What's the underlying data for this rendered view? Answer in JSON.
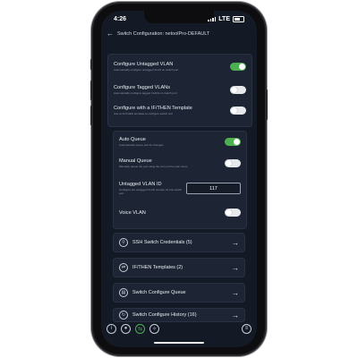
{
  "status": {
    "time": "4:26",
    "network": "LTE"
  },
  "nav": {
    "title": "Switch Configuration: netoolPro-DEFAULT"
  },
  "configure": [
    {
      "label": "Configure Untagged VLAN",
      "desc": "Automatically configure untagged VLAN on switch port",
      "on": true
    },
    {
      "label": "Configure Tagged VLANs",
      "desc": "Automatically configure tagged VLANs on switch port",
      "on": false
    },
    {
      "label": "Configure with a IF/THEN Template",
      "desc": "Use an IF/THEN template to configure switch port",
      "on": false
    }
  ],
  "queue": [
    {
      "label": "Auto Queue",
      "desc": "Automatically queue port for changes",
      "on": true
    },
    {
      "label": "Manual Queue",
      "desc": "Manually queue the port using the icon on the main menu",
      "on": false
    }
  ],
  "untagged_vlan": {
    "label": "Untagged VLAN ID",
    "desc": "Configure the untagged VLAN number for this switch port",
    "value": "117"
  },
  "voice_vlan": {
    "label": "Voice VLAN",
    "on": false
  },
  "links": [
    {
      "label": "SSH Switch Credentials (5)",
      "icon": "key-icon"
    },
    {
      "label": "IF/THEN Templates (2)",
      "icon": "arrows-icon"
    },
    {
      "label": "Switch Configure Queue",
      "icon": "queue-icon"
    },
    {
      "label": "Switch Configure History (16)",
      "icon": "history-icon"
    }
  ],
  "tabs": [
    "info-icon",
    "light-icon",
    "switch-icon",
    "tools-icon",
    "menu-icon"
  ],
  "colors": {
    "accent": "#4caf50",
    "background": "#131a26",
    "card": "#1d2433"
  }
}
